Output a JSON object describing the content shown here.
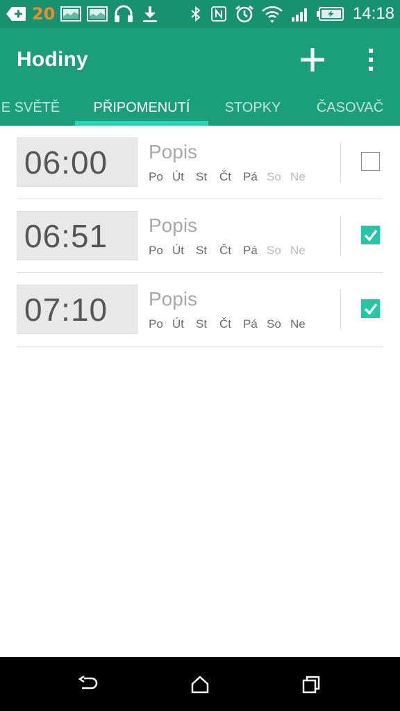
{
  "status_bar": {
    "notification_count": "20",
    "time": "14:18",
    "left_icons": [
      "plus-back-icon",
      "picture-icon",
      "picture-icon",
      "headphones-icon",
      "download-icon"
    ],
    "right_icons": [
      "bluetooth-icon",
      "nfc-icon",
      "alarm-icon",
      "wifi-icon",
      "signal-icon",
      "battery-charging-icon"
    ]
  },
  "app": {
    "title": "Hodiny",
    "actions": [
      "add-icon",
      "overflow-menu-icon"
    ]
  },
  "tabs": [
    {
      "label": "E SVĚTĚ",
      "active": false
    },
    {
      "label": "PŘIPOMENUTÍ",
      "active": true
    },
    {
      "label": "STOPKY",
      "active": false
    },
    {
      "label": "ČASOVAČ",
      "active": false
    }
  ],
  "alarms": [
    {
      "time": "06:00",
      "description": "Popis",
      "days": [
        {
          "label": "Po",
          "on": true
        },
        {
          "label": "Út",
          "on": true
        },
        {
          "label": "St",
          "on": true
        },
        {
          "label": "Čt",
          "on": true
        },
        {
          "label": "Pá",
          "on": true
        },
        {
          "label": "So",
          "on": false
        },
        {
          "label": "Ne",
          "on": false
        }
      ],
      "enabled": false
    },
    {
      "time": "06:51",
      "description": "Popis",
      "days": [
        {
          "label": "Po",
          "on": true
        },
        {
          "label": "Út",
          "on": true
        },
        {
          "label": "St",
          "on": true
        },
        {
          "label": "Čt",
          "on": true
        },
        {
          "label": "Pá",
          "on": true
        },
        {
          "label": "So",
          "on": false
        },
        {
          "label": "Ne",
          "on": false
        }
      ],
      "enabled": true
    },
    {
      "time": "07:10",
      "description": "Popis",
      "days": [
        {
          "label": "Po",
          "on": true
        },
        {
          "label": "Út",
          "on": true
        },
        {
          "label": "St",
          "on": true
        },
        {
          "label": "Čt",
          "on": true
        },
        {
          "label": "Pá",
          "on": true
        },
        {
          "label": "So",
          "on": true
        },
        {
          "label": "Ne",
          "on": true
        }
      ],
      "enabled": true
    }
  ],
  "nav": [
    "back-icon",
    "home-icon",
    "recents-icon"
  ],
  "colors": {
    "status_bar": "#16926e",
    "action_bar": "#1b9e7a",
    "accent": "#22c7a6",
    "notification_count": "#f08a2a"
  }
}
